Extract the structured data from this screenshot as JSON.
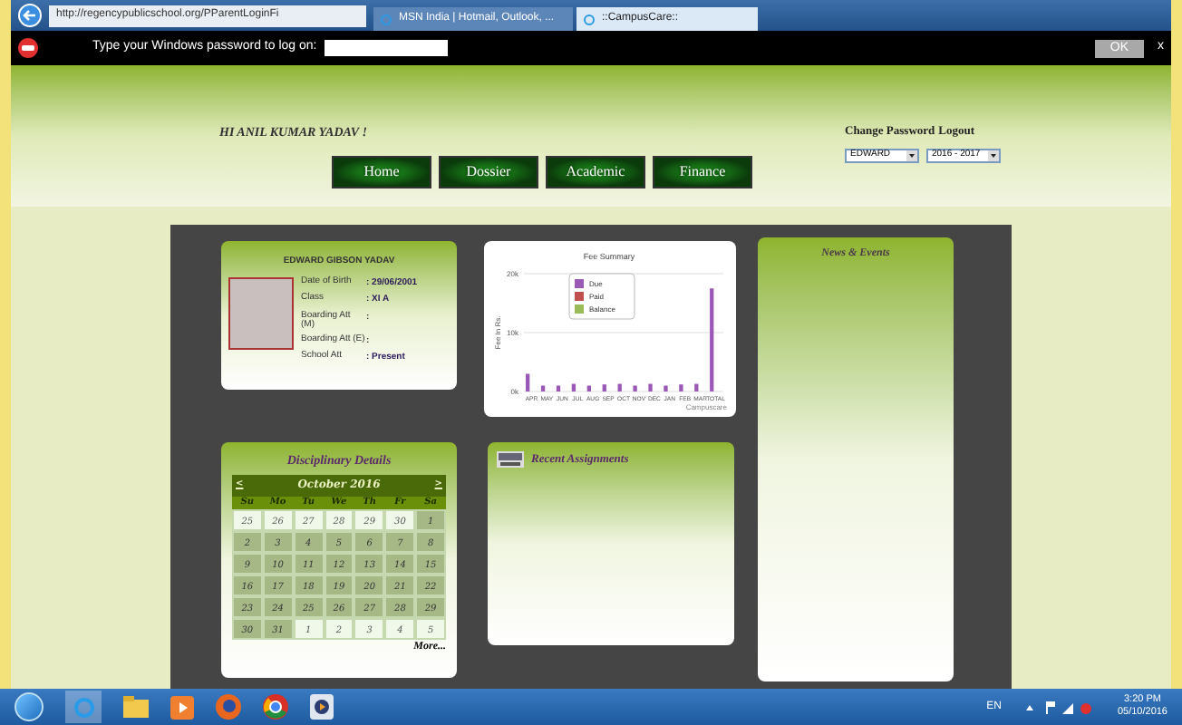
{
  "browser": {
    "address": "http://regencypublicschool.org/PParentLoginFi",
    "tabs": [
      {
        "label": "MSN India | Hotmail, Outlook, ...",
        "selected": false
      },
      {
        "label": "::CampusCare::",
        "selected": true
      }
    ]
  },
  "password_bar": {
    "prompt": "Type your Windows password to log on:",
    "ok": "OK",
    "close": "x"
  },
  "header": {
    "greeting": "HI ANIL KUMAR YADAV !",
    "links": [
      "Change Password",
      "Logout"
    ],
    "nav": [
      "Home",
      "Dossier",
      "Academic",
      "Finance"
    ],
    "student_select": "EDWARD",
    "session_select": "2016 - 2017"
  },
  "profile": {
    "name": "EDWARD GIBSON YADAV",
    "fields": [
      {
        "label": "Date of Birth",
        "value": ": 29/06/2001"
      },
      {
        "label": "Class",
        "value": ": XI A"
      },
      {
        "label": "Boarding Att (M)",
        "value": ":"
      },
      {
        "label": "Boarding Att (E)",
        "value": ":"
      },
      {
        "label": "School Att",
        "value": ": Present"
      }
    ]
  },
  "fee_summary": {
    "chart_data": {
      "type": "bar",
      "title": "Fee Summary",
      "ylabel": "Fee In Rs.",
      "categories": [
        "APR",
        "MAY",
        "JUN",
        "JUL",
        "AUG",
        "SEP",
        "OCT",
        "NOV",
        "DEC",
        "JAN",
        "FEB",
        "MAR",
        "TOTAL"
      ],
      "ylim": [
        0,
        20000
      ],
      "yticks": [
        {
          "value": 0,
          "label": "0k"
        },
        {
          "value": 10000,
          "label": "10k"
        },
        {
          "value": 20000,
          "label": "20k"
        }
      ],
      "series": [
        {
          "name": "Due",
          "color": "#9b59b6",
          "values": [
            3000,
            1000,
            1000,
            1300,
            1000,
            1200,
            1300,
            1000,
            1300,
            1000,
            1200,
            1300,
            17500
          ]
        },
        {
          "name": "Paid",
          "color": "#c0504d",
          "values": [
            null,
            null,
            null,
            null,
            null,
            null,
            null,
            null,
            null,
            null,
            null,
            null,
            null
          ]
        },
        {
          "name": "Balance",
          "color": "#9bbb59",
          "values": [
            null,
            null,
            null,
            null,
            null,
            null,
            null,
            null,
            null,
            null,
            null,
            null,
            null
          ]
        }
      ]
    },
    "credit": "Campuscare"
  },
  "news": {
    "title": "News & Events"
  },
  "discipline": {
    "title": "Disciplinary Details",
    "month": "October 2016",
    "prev": "<",
    "next": ">",
    "weekdays": [
      "Su",
      "Mo",
      "Tu",
      "We",
      "Th",
      "Fr",
      "Sa"
    ],
    "weeks": [
      [
        {
          "day": "25",
          "in_month": false
        },
        {
          "day": "26",
          "in_month": false
        },
        {
          "day": "27",
          "in_month": false
        },
        {
          "day": "28",
          "in_month": false
        },
        {
          "day": "29",
          "in_month": false
        },
        {
          "day": "30",
          "in_month": false
        },
        {
          "day": "1",
          "in_month": true
        }
      ],
      [
        {
          "day": "2",
          "in_month": true
        },
        {
          "day": "3",
          "in_month": true
        },
        {
          "day": "4",
          "in_month": true
        },
        {
          "day": "5",
          "in_month": true
        },
        {
          "day": "6",
          "in_month": true
        },
        {
          "day": "7",
          "in_month": true
        },
        {
          "day": "8",
          "in_month": true
        }
      ],
      [
        {
          "day": "9",
          "in_month": true
        },
        {
          "day": "10",
          "in_month": true
        },
        {
          "day": "11",
          "in_month": true
        },
        {
          "day": "12",
          "in_month": true
        },
        {
          "day": "13",
          "in_month": true
        },
        {
          "day": "14",
          "in_month": true
        },
        {
          "day": "15",
          "in_month": true
        }
      ],
      [
        {
          "day": "16",
          "in_month": true
        },
        {
          "day": "17",
          "in_month": true
        },
        {
          "day": "18",
          "in_month": true
        },
        {
          "day": "19",
          "in_month": true
        },
        {
          "day": "20",
          "in_month": true
        },
        {
          "day": "21",
          "in_month": true
        },
        {
          "day": "22",
          "in_month": true
        }
      ],
      [
        {
          "day": "23",
          "in_month": true
        },
        {
          "day": "24",
          "in_month": true
        },
        {
          "day": "25",
          "in_month": true
        },
        {
          "day": "26",
          "in_month": true
        },
        {
          "day": "27",
          "in_month": true
        },
        {
          "day": "28",
          "in_month": true
        },
        {
          "day": "29",
          "in_month": true
        }
      ],
      [
        {
          "day": "30",
          "in_month": true
        },
        {
          "day": "31",
          "in_month": true
        },
        {
          "day": "1",
          "in_month": false
        },
        {
          "day": "2",
          "in_month": false
        },
        {
          "day": "3",
          "in_month": false
        },
        {
          "day": "4",
          "in_month": false
        },
        {
          "day": "5",
          "in_month": false
        }
      ]
    ],
    "more": "More..."
  },
  "assignments": {
    "title": "Recent Assignments"
  },
  "taskbar": {
    "language": "EN",
    "time": "3:20 PM",
    "date": "05/10/2016"
  }
}
